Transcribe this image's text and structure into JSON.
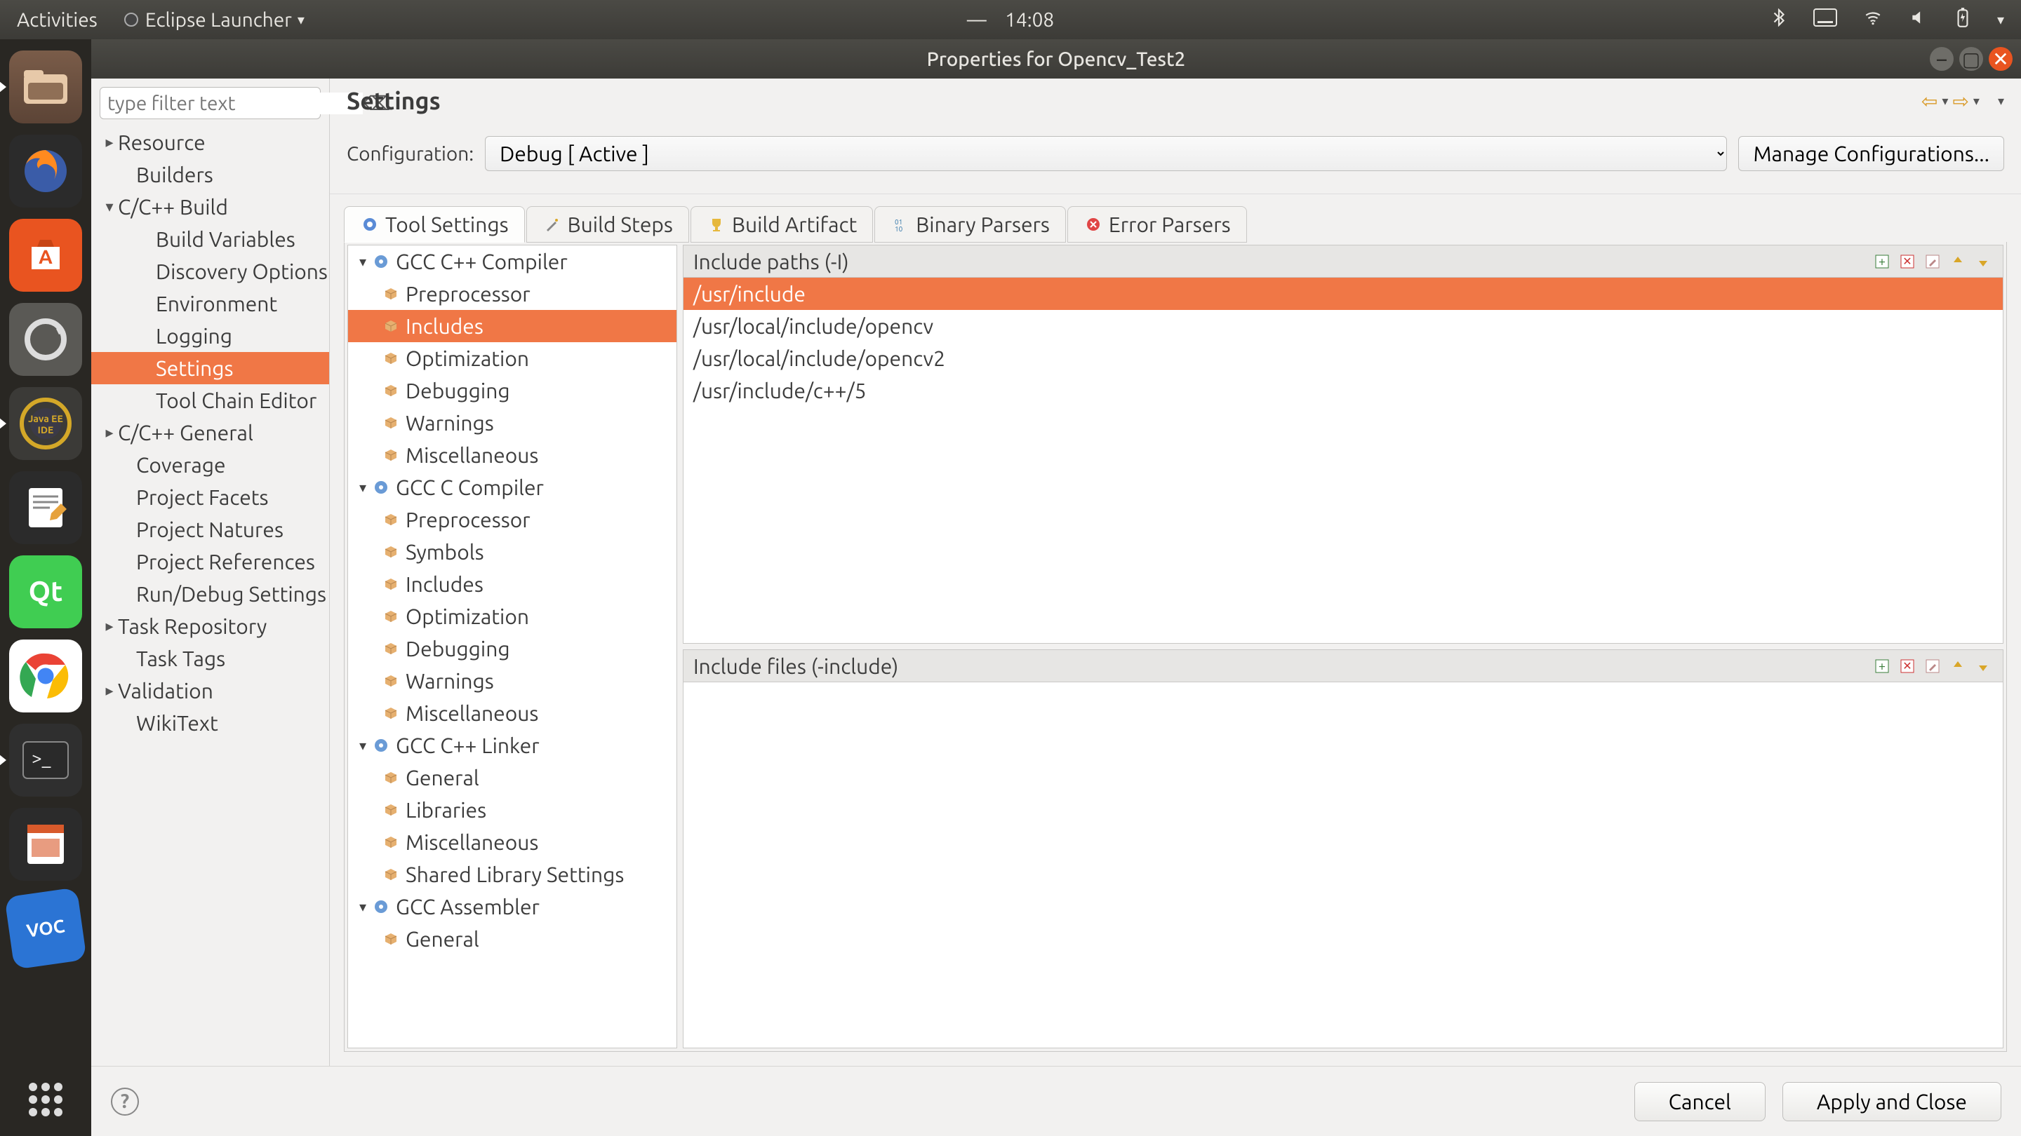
{
  "ubuntu_bar": {
    "activities": "Activities",
    "app_menu": "Eclipse Launcher",
    "time": "14:08"
  },
  "window": {
    "title": "Properties for Opencv_Test2"
  },
  "filter": {
    "placeholder": "type filter text"
  },
  "sidebar": {
    "items": [
      {
        "label": "Resource",
        "level": 0,
        "arrow": "▸"
      },
      {
        "label": "Builders",
        "level": 1,
        "arrow": ""
      },
      {
        "label": "C/C++ Build",
        "level": 0,
        "arrow": "▾"
      },
      {
        "label": "Build Variables",
        "level": 2,
        "arrow": ""
      },
      {
        "label": "Discovery Options",
        "level": 2,
        "arrow": ""
      },
      {
        "label": "Environment",
        "level": 2,
        "arrow": ""
      },
      {
        "label": "Logging",
        "level": 2,
        "arrow": ""
      },
      {
        "label": "Settings",
        "level": 2,
        "arrow": "",
        "selected": true
      },
      {
        "label": "Tool Chain Editor",
        "level": 2,
        "arrow": ""
      },
      {
        "label": "C/C++ General",
        "level": 0,
        "arrow": "▸"
      },
      {
        "label": "Coverage",
        "level": 1,
        "arrow": ""
      },
      {
        "label": "Project Facets",
        "level": 1,
        "arrow": ""
      },
      {
        "label": "Project Natures",
        "level": 1,
        "arrow": ""
      },
      {
        "label": "Project References",
        "level": 1,
        "arrow": ""
      },
      {
        "label": "Run/Debug Settings",
        "level": 1,
        "arrow": ""
      },
      {
        "label": "Task Repository",
        "level": 0,
        "arrow": "▸"
      },
      {
        "label": "Task Tags",
        "level": 1,
        "arrow": ""
      },
      {
        "label": "Validation",
        "level": 0,
        "arrow": "▸"
      },
      {
        "label": "WikiText",
        "level": 1,
        "arrow": ""
      }
    ]
  },
  "main": {
    "title": "Settings",
    "config_label": "Configuration:",
    "config_value": "Debug  [ Active ]",
    "manage_label": "Manage Configurations..."
  },
  "tabs": [
    {
      "label": "Tool Settings",
      "active": true,
      "icon": "gear-blue"
    },
    {
      "label": "Build Steps",
      "active": false,
      "icon": "wand"
    },
    {
      "label": "Build Artifact",
      "active": false,
      "icon": "trophy"
    },
    {
      "label": "Binary Parsers",
      "active": false,
      "icon": "binary"
    },
    {
      "label": "Error Parsers",
      "active": false,
      "icon": "error"
    }
  ],
  "tool_tree": [
    {
      "label": "GCC C++ Compiler",
      "level": 0,
      "arrow": "▾",
      "icon": "gear-blue"
    },
    {
      "label": "Preprocessor",
      "level": 1,
      "icon": "pkg"
    },
    {
      "label": "Includes",
      "level": 1,
      "icon": "pkg",
      "selected": true
    },
    {
      "label": "Optimization",
      "level": 1,
      "icon": "pkg"
    },
    {
      "label": "Debugging",
      "level": 1,
      "icon": "pkg"
    },
    {
      "label": "Warnings",
      "level": 1,
      "icon": "pkg"
    },
    {
      "label": "Miscellaneous",
      "level": 1,
      "icon": "pkg"
    },
    {
      "label": "GCC C Compiler",
      "level": 0,
      "arrow": "▾",
      "icon": "gear-blue"
    },
    {
      "label": "Preprocessor",
      "level": 1,
      "icon": "pkg"
    },
    {
      "label": "Symbols",
      "level": 1,
      "icon": "pkg"
    },
    {
      "label": "Includes",
      "level": 1,
      "icon": "pkg"
    },
    {
      "label": "Optimization",
      "level": 1,
      "icon": "pkg"
    },
    {
      "label": "Debugging",
      "level": 1,
      "icon": "pkg"
    },
    {
      "label": "Warnings",
      "level": 1,
      "icon": "pkg"
    },
    {
      "label": "Miscellaneous",
      "level": 1,
      "icon": "pkg"
    },
    {
      "label": "GCC C++ Linker",
      "level": 0,
      "arrow": "▾",
      "icon": "gear-blue"
    },
    {
      "label": "General",
      "level": 1,
      "icon": "pkg"
    },
    {
      "label": "Libraries",
      "level": 1,
      "icon": "pkg"
    },
    {
      "label": "Miscellaneous",
      "level": 1,
      "icon": "pkg"
    },
    {
      "label": "Shared Library Settings",
      "level": 1,
      "icon": "pkg"
    },
    {
      "label": "GCC Assembler",
      "level": 0,
      "arrow": "▾",
      "icon": "gear-blue"
    },
    {
      "label": "General",
      "level": 1,
      "icon": "pkg"
    }
  ],
  "panels": {
    "include_paths": {
      "title": "Include paths (-I)",
      "rows": [
        {
          "value": "/usr/include",
          "selected": true
        },
        {
          "value": "/usr/local/include/opencv"
        },
        {
          "value": "/usr/local/include/opencv2"
        },
        {
          "value": "/usr/include/c++/5"
        }
      ]
    },
    "include_files": {
      "title": "Include files (-include)",
      "rows": []
    }
  },
  "footer": {
    "cancel": "Cancel",
    "apply": "Apply and Close"
  }
}
